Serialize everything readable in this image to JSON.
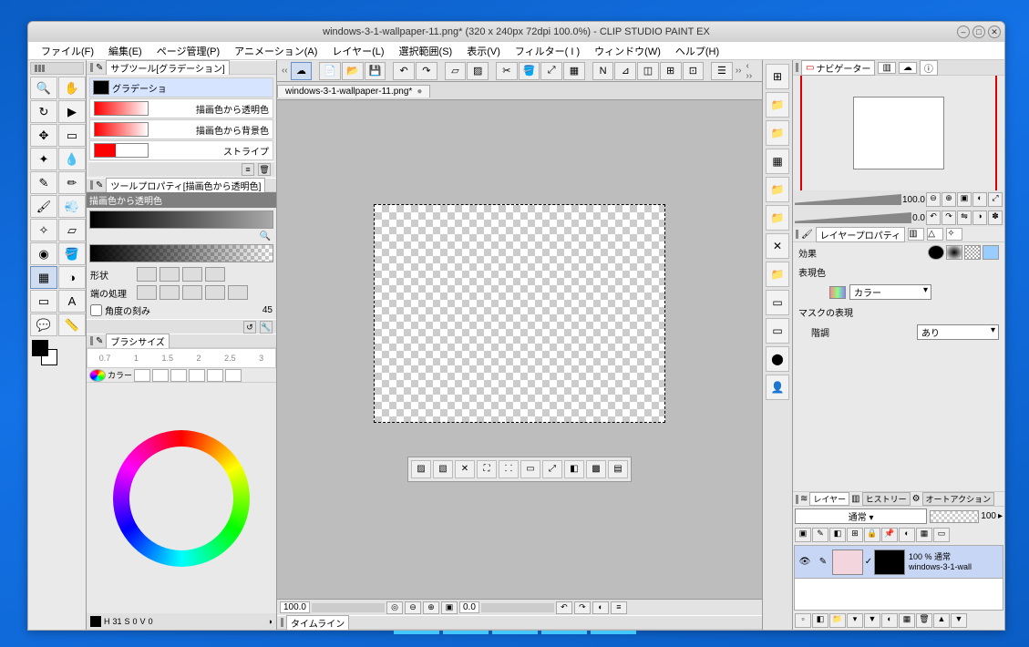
{
  "title": "windows-3-1-wallpaper-11.png* (320 x 240px 72dpi 100.0%)    - CLIP STUDIO PAINT EX",
  "menu": [
    "ファイル(F)",
    "編集(E)",
    "ページ管理(P)",
    "アニメーション(A)",
    "レイヤー(L)",
    "選択範囲(S)",
    "表示(V)",
    "フィルター( I )",
    "ウィンドウ(W)",
    "ヘルプ(H)"
  ],
  "subtool": {
    "header": "サブツール[グラデーション]",
    "group": "グラデーショ",
    "items": [
      {
        "label": "描画色から透明色"
      },
      {
        "label": "描画色から背景色"
      },
      {
        "label": "ストライプ"
      }
    ]
  },
  "toolprop": {
    "header": "ツールプロパティ[描画色から透明色]",
    "title": "描画色から透明色",
    "shape_label": "形状",
    "edge_label": "端の処理",
    "angle_label": "角度の刻み",
    "angle_val": "45"
  },
  "brush": {
    "header": "ブラシサイズ",
    "ticks": [
      "0.7",
      "1",
      "1.5",
      "2",
      "2.5",
      "3"
    ]
  },
  "color": {
    "tab": "カラー",
    "h_label": "H",
    "h": "31",
    "s_label": "S",
    "s": "0",
    "v_label": "V",
    "v": "0"
  },
  "doc_tab": "windows-3-1-wallpaper-11.png*",
  "status": {
    "zoom": "100.0",
    "angle": "0.0"
  },
  "timeline": "タイムライン",
  "navigator": {
    "tab": "ナビゲーター",
    "zoom": "100.0",
    "angle": "0.0"
  },
  "layerprop": {
    "title": "レイヤープロパティ",
    "effect": "効果",
    "rendercolor": "表現色",
    "rendercolor_val": "カラー",
    "mask": "マスクの表現",
    "tone": "階調",
    "tone_val": "あり"
  },
  "layers": {
    "tab1": "レイヤー",
    "tab2": "ヒストリー",
    "tab3": "オートアクション",
    "blend": "通常",
    "opacity": "100",
    "row": {
      "pct": "100 %",
      "mode": "通常",
      "name": "windows-3-1-wall"
    }
  }
}
